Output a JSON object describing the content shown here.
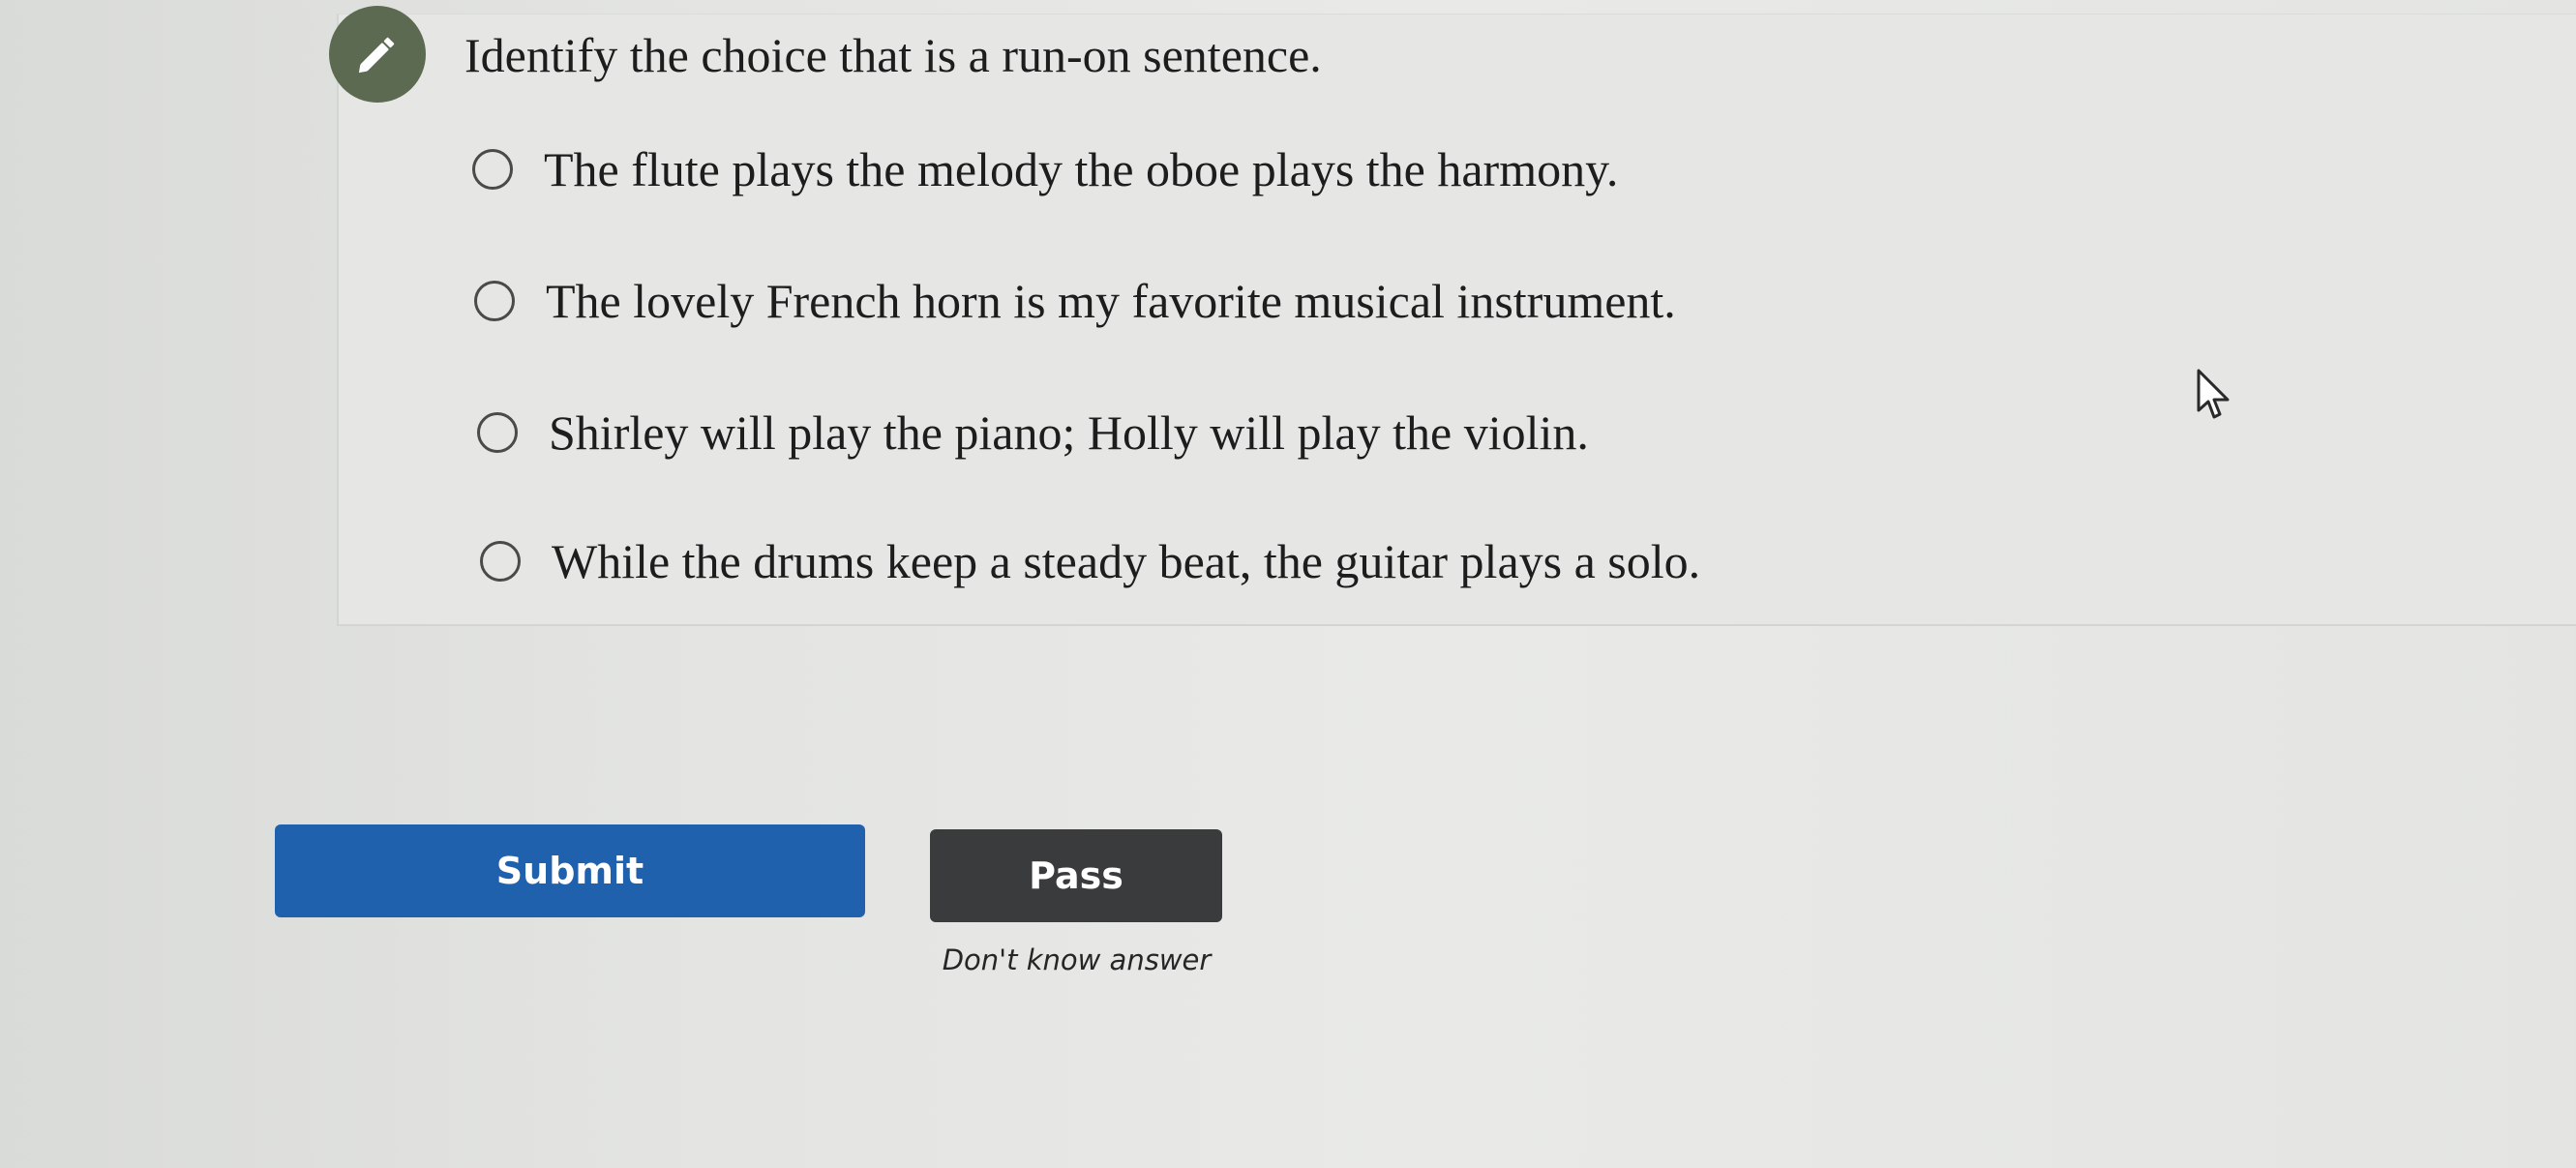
{
  "question": {
    "icon": "pencil-icon",
    "badge_color": "#5b6a50",
    "text": "Identify the choice that is a run-on sentence."
  },
  "options": [
    {
      "label": "The flute plays the melody the oboe plays the harmony.",
      "selected": false
    },
    {
      "label": "The lovely French horn is my favorite musical instrument.",
      "selected": false
    },
    {
      "label": "Shirley will play the piano; Holly will play the violin.",
      "selected": false
    },
    {
      "label": "While the drums keep a steady beat, the guitar plays a solo.",
      "selected": false
    }
  ],
  "actions": {
    "submit_label": "Submit",
    "submit_color": "#2061ad",
    "pass_label": "Pass",
    "pass_color": "#3a3b3d",
    "dont_know_label": "Don't know answer"
  },
  "cursor": {
    "icon": "arrow-cursor-icon"
  }
}
